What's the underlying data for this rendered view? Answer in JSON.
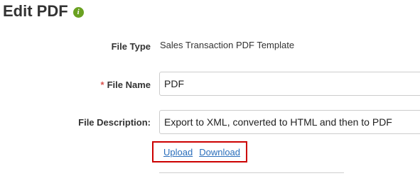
{
  "page": {
    "title": "Edit PDF",
    "info_icon_glyph": "i"
  },
  "form": {
    "file_type_label": "File Type",
    "file_type_value": "Sales Transaction PDF Template",
    "required_marker": "*",
    "file_name_label": "File Name",
    "file_name_value": "PDF",
    "file_description_label": "File Description:",
    "file_description_value": "Export to XML, converted to HTML and then to PDF"
  },
  "links": {
    "upload": "Upload",
    "download": "Download"
  },
  "colors": {
    "info_icon": "#6aa121",
    "required": "#d9534f",
    "link": "#2a6ebb",
    "highlight_box": "#cc0000"
  },
  "icons": {
    "info": "info-icon"
  }
}
